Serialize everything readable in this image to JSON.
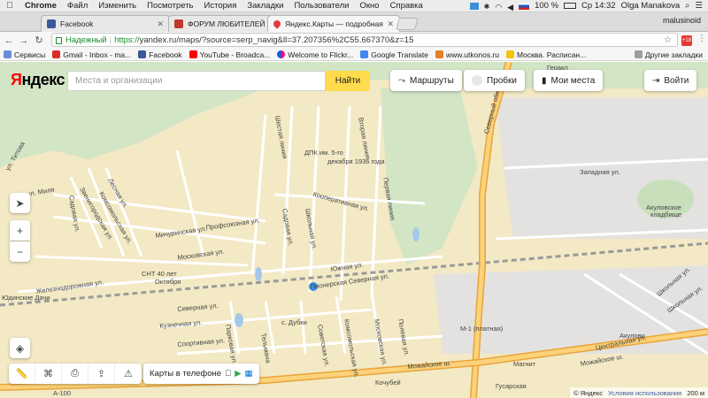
{
  "menubar": {
    "app": "Chrome",
    "items": [
      "Файл",
      "Изменить",
      "Посмотреть",
      "История",
      "Закладки",
      "Пользователи",
      "Окно",
      "Справка"
    ],
    "battery": "100 %",
    "clock": "Ср 14:32",
    "user": "Olga Manakova"
  },
  "tabs": [
    {
      "title": "Facebook",
      "icon_color": "#3b5998"
    },
    {
      "title": "ФОРУМ ЛЮБИТЕЛЕЙ КОЛЛ",
      "icon_color": "#c0392b"
    },
    {
      "title": "Яндекс.Карты — подробная",
      "icon_color": "#e53935"
    }
  ],
  "profile_name": "malusinoid",
  "address": {
    "secure_label": "Надежный",
    "scheme": "https://",
    "rest": "yandex.ru/maps/?source=serp_navig&ll=37.207356%2C55.667370&z=15",
    "extension_badge": "+18"
  },
  "bookmarks": {
    "items": [
      {
        "label": "Сервисы",
        "color": "#6b8cd6"
      },
      {
        "label": "Gmail - Inbox - ma...",
        "color": "#d93025"
      },
      {
        "label": "Facebook",
        "color": "#3b5998"
      },
      {
        "label": "YouTube - Broadca...",
        "color": "#ff0000"
      },
      {
        "label": "Welcome to Flickr...",
        "color": "#ff0084"
      },
      {
        "label": "Google Translate",
        "color": "#4285f4"
      },
      {
        "label": "www.utkonos.ru",
        "color": "#e67e22"
      },
      {
        "label": "Москва. Расписан...",
        "color": "#f1c40f"
      }
    ],
    "other": "Другие закладки"
  },
  "map": {
    "logo_red": "Я",
    "logo_black": "ндекс",
    "search_placeholder": "Места и организации",
    "search_button": "Найти",
    "routes": "Маршруты",
    "traffic": "Пробки",
    "my_places": "Мои места",
    "login": "Войти",
    "phone_label": "Карты в телефоне",
    "copyright": "© Яндекс",
    "terms": "Условия использования",
    "scale": "200 м",
    "labels": [
      "ДПК им. 5-го",
      "декабря 1936 года",
      "Геракл",
      "Западная ул.",
      "Северный обход",
      "Акуловское",
      "кладбище",
      "Шестая линия",
      "Вторая линия",
      "Первая линия",
      "Кооперативная ул.",
      "Садовая ул.",
      "Школьная ул.",
      "Мичуринская ул.",
      "Профсоюзная ул.",
      "Московская ул.",
      "СНТ 40 лет",
      "Октября",
      "Железнодорожная ул.",
      "Южная ул.",
      "Пионерская Северная ул.",
      "Юдинские Дачи",
      "Северная ул.",
      "Кузнечная ул.",
      "Спортивная ул.",
      "Парковая ул.",
      "с. Дубки",
      "Тельмана",
      "Советская ул.",
      "Комсомольская ул.",
      "Московская ул.",
      "Полевая ул.",
      "М-1 (платная)",
      "Акулово",
      "Центральная ул.",
      "Школьная ул.",
      "Можайское ш.",
      "Можайское ш.",
      "Можайское ш.",
      "Кочубей",
      "Гусарская",
      "Магнит",
      "ул. Титова",
      "ул. Миля",
      "Садовая ул.",
      "Звенигородская ул.",
      "Комсомольская ул.",
      "Лесная ул.",
      "А-100",
      "Школьная ул."
    ]
  }
}
